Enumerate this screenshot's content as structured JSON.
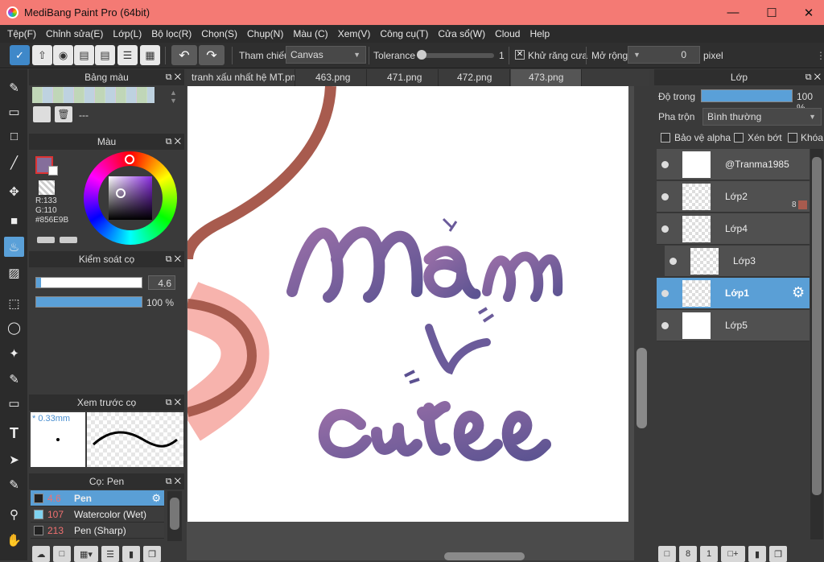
{
  "window": {
    "title": "MediBang Paint Pro (64bit)"
  },
  "menu": [
    "Tệp(F)",
    "Chỉnh sửa(E)",
    "Lớp(L)",
    "Bộ lọc(R)",
    "Chọn(S)",
    "Chụp(N)",
    "Màu (C)",
    "Xem(V)",
    "Công cụ(T)",
    "Cửa sổ(W)",
    "Cloud",
    "Help"
  ],
  "toolbar": {
    "reference_label": "Tham chiếu",
    "reference_value": "Canvas",
    "tolerance_label": "Tolerance",
    "tolerance_value": "1",
    "antialias_label": "Khử răng cưa",
    "expand_label": "Mở rộng",
    "expand_value": "0",
    "expand_unit": "pixel"
  },
  "palette_panel": {
    "title": "Bảng màu",
    "name": "---"
  },
  "color_panel": {
    "title": "Màu",
    "r": "R:133",
    "g": "G:110",
    "hex": "#856E9B",
    "main_color": "#856E9B"
  },
  "brush_control": {
    "title": "Kiểm soát cọ",
    "size": "4.6",
    "opacity": "100 %",
    "opacity_fraction": 1.0
  },
  "brush_preview": {
    "title": "Xem trước cọ",
    "size_label": "* 0.33mm"
  },
  "brush_list": {
    "title": "Cọ: Pen",
    "items": [
      {
        "size": "4.6",
        "name": "Pen",
        "color": "#2a2a2a"
      },
      {
        "size": "107",
        "name": "Watercolor (Wet)",
        "color": "#7fd3f0"
      },
      {
        "size": "213",
        "name": "Pen (Sharp)",
        "color": "#2a2a2a"
      }
    ]
  },
  "tabs": [
    "tranh xấu nhất hệ MT.png",
    "463.png",
    "471.png",
    "472.png",
    "473.png"
  ],
  "layers_panel": {
    "title": "Lớp",
    "opacity_label": "Độ trong",
    "opacity_value": "100 %",
    "blend_label": "Pha trộn",
    "blend_value": "Bình thường",
    "protect_alpha": "Bảo vệ alpha",
    "clip": "Xén bớt",
    "lock": "Khóa",
    "layers": [
      {
        "name": "@Tranma1985",
        "badge": ""
      },
      {
        "name": "Lớp2",
        "badge": "8"
      },
      {
        "name": "Lớp4",
        "badge": ""
      },
      {
        "name": "Lớp3",
        "badge": ""
      },
      {
        "name": "Lớp1",
        "badge": ""
      },
      {
        "name": "Lớp5",
        "badge": ""
      }
    ]
  },
  "icons": {
    "theme": "#5aa0d8"
  }
}
